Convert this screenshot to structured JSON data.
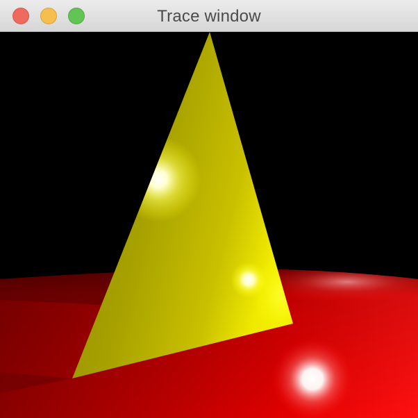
{
  "window": {
    "title": "Trace window",
    "controls": {
      "close": "close-button",
      "minimize": "minimize-button",
      "zoom": "zoom-button"
    }
  },
  "scene": {
    "background_color": "#000000",
    "objects": [
      {
        "name": "yellow-triangle",
        "color": "#b8b000"
      },
      {
        "name": "red-plane",
        "color": "#ff0000"
      }
    ],
    "highlights": 3
  }
}
